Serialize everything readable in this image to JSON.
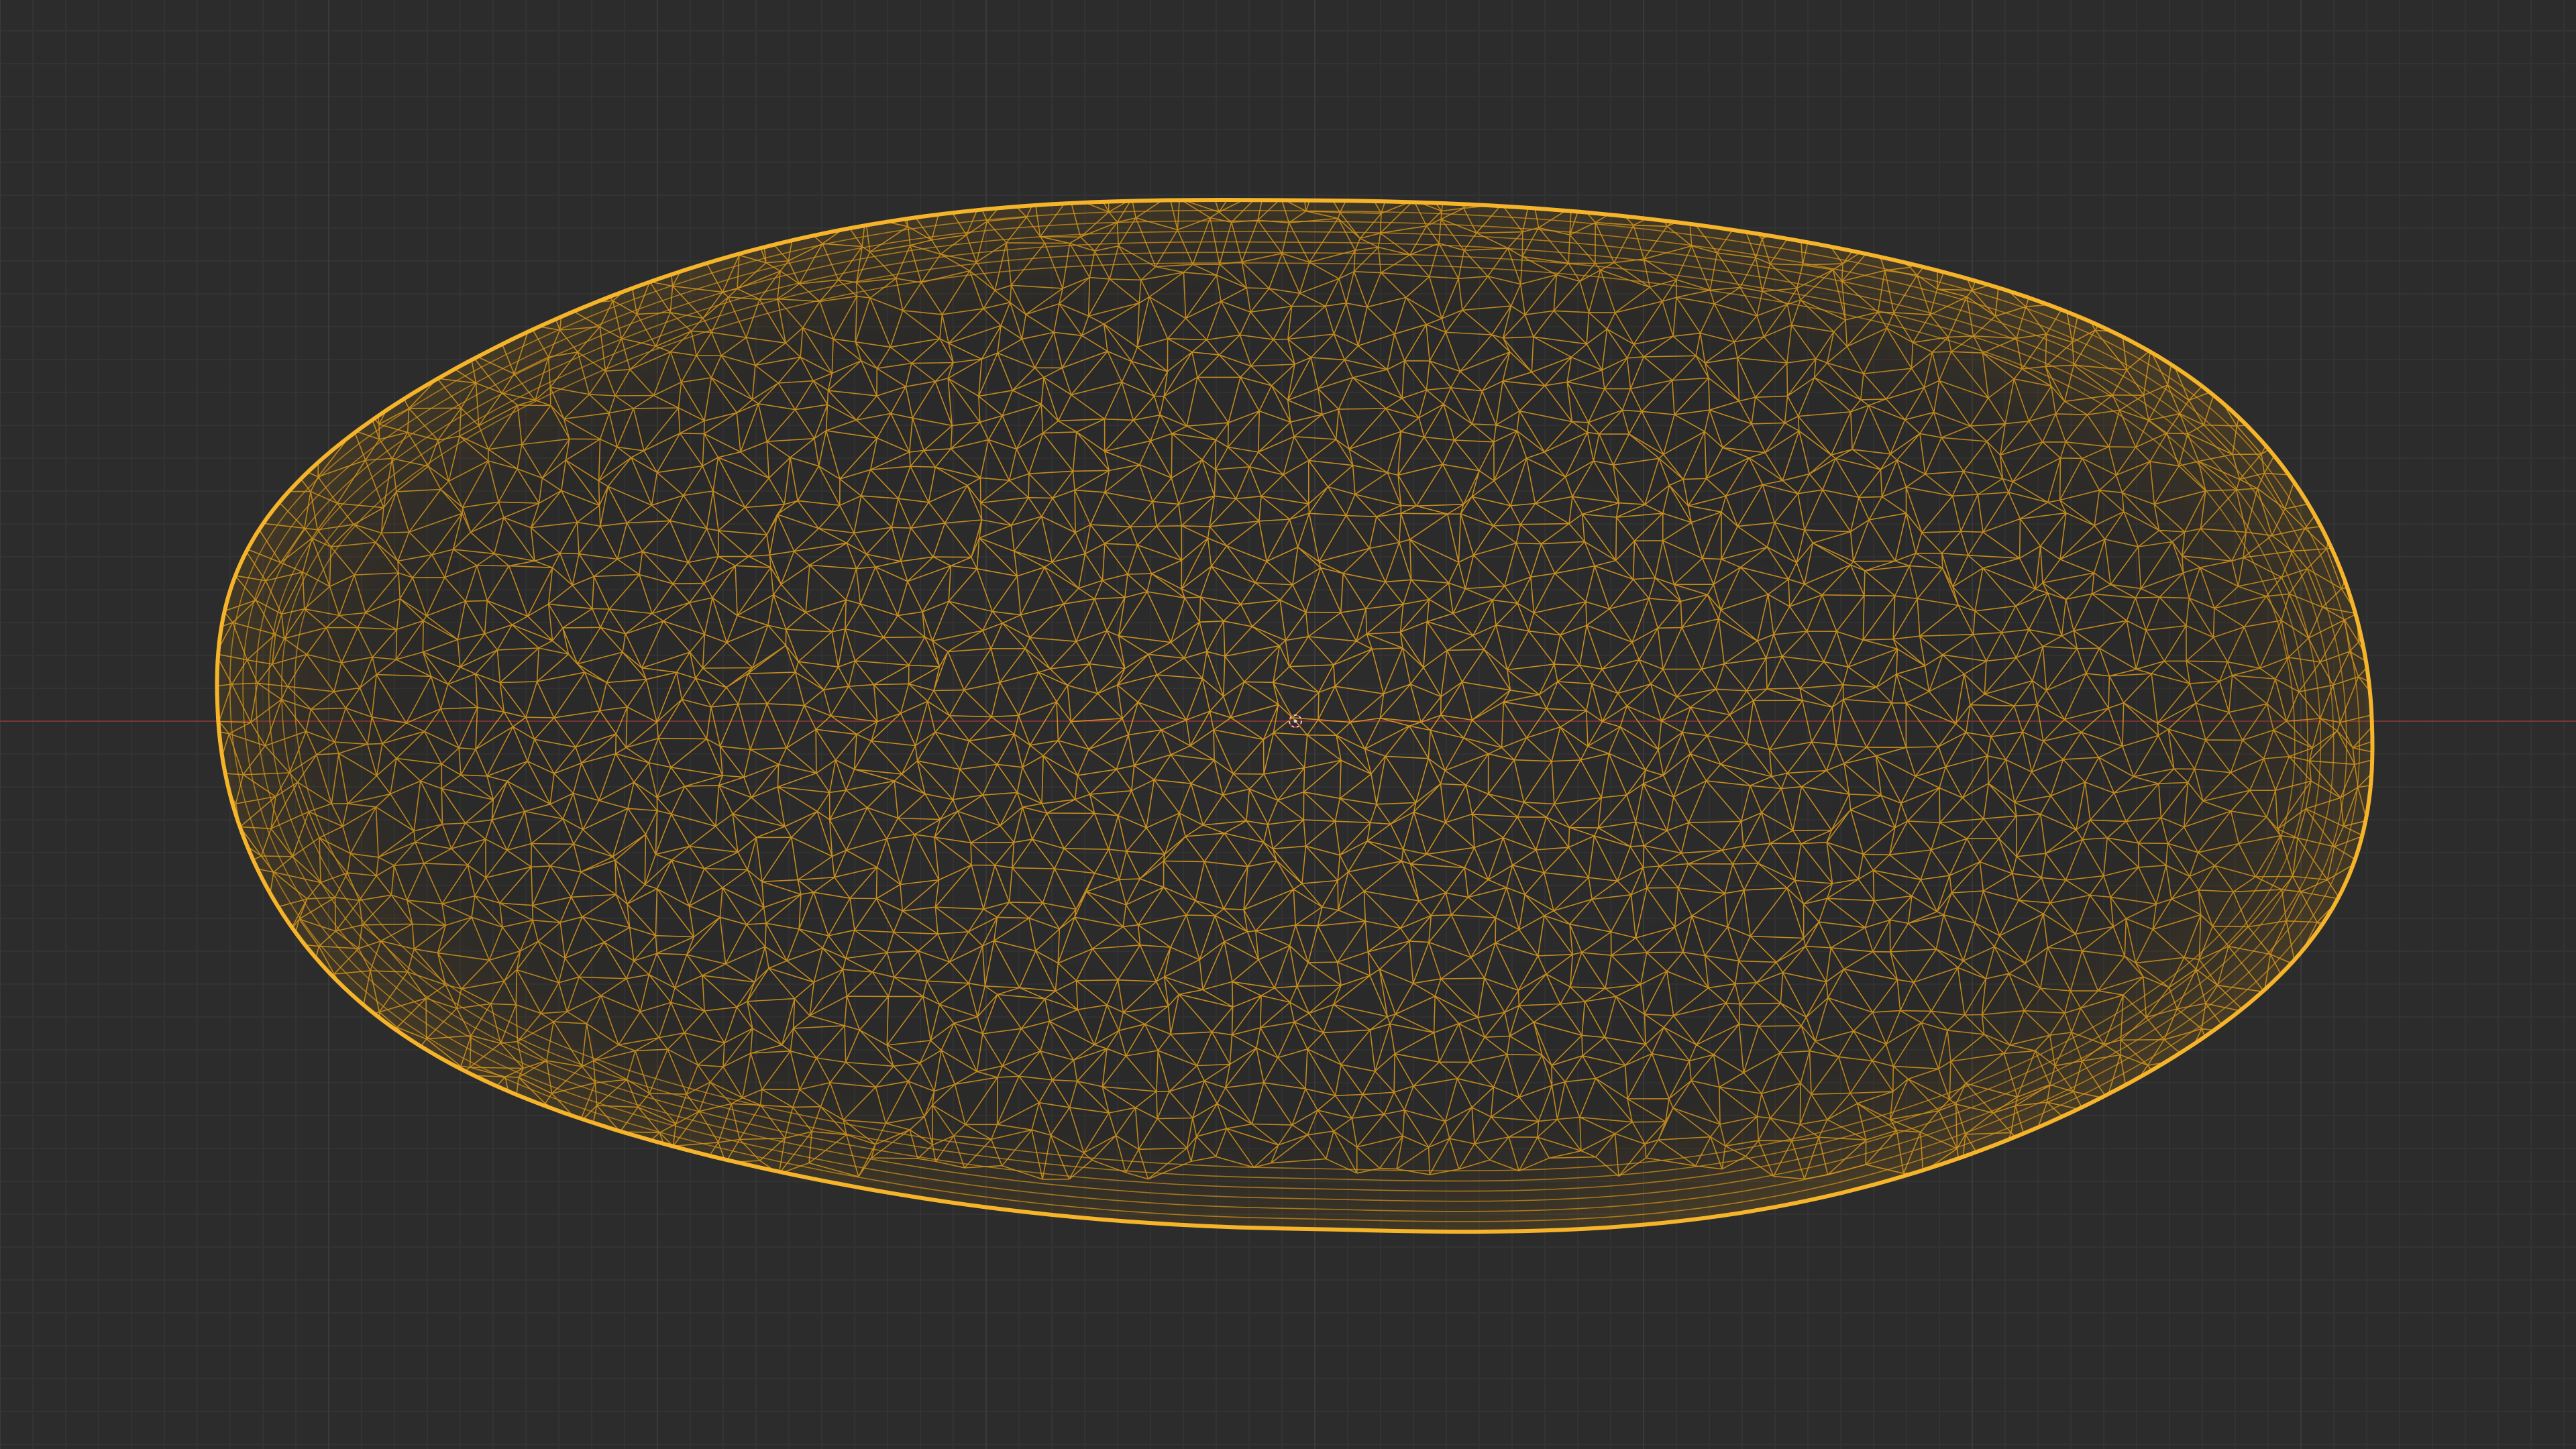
{
  "viewport": {
    "background_color": "#2c2c2c",
    "grid_minor_color": "#333333",
    "grid_major_color": "#3a3a3a",
    "x_axis_color": "#7a3535",
    "mesh_edge_color": "#e8a21f",
    "mesh_outline_color": "#f5b42a",
    "shading": "wireframe",
    "object": "mesh-object-selected",
    "cursor_icon": "3d-cursor-icon"
  }
}
